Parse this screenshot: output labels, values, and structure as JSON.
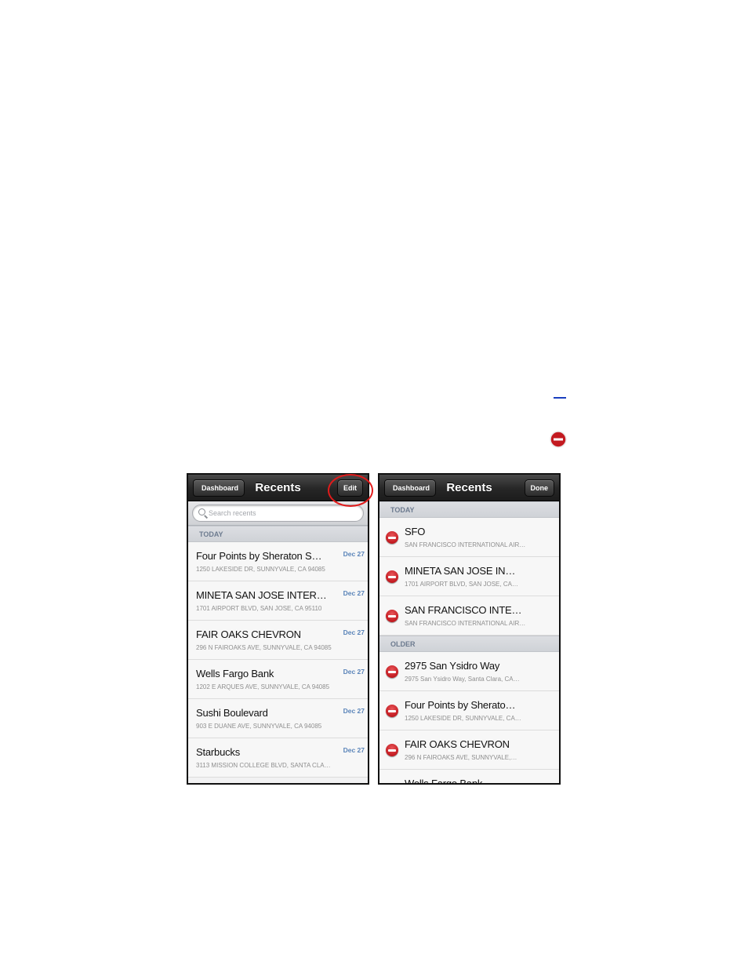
{
  "doc": {
    "link_text": ""
  },
  "left": {
    "nav": {
      "back_label": "Dashboard",
      "title": "Recents",
      "action_label": "Edit"
    },
    "search": {
      "placeholder": "Search recents"
    },
    "section": "TODAY",
    "items": [
      {
        "title": "Four Points by Sheraton S…",
        "subtitle": "1250 LAKESIDE DR, SUNNYVALE, CA 94085",
        "date": "Dec 27"
      },
      {
        "title": "MINETA SAN JOSE INTER…",
        "subtitle": "1701 AIRPORT BLVD, SAN JOSE, CA 95110",
        "date": "Dec 27"
      },
      {
        "title": "FAIR OAKS CHEVRON",
        "subtitle": "296 N FAIROAKS AVE, SUNNYVALE, CA 94085",
        "date": "Dec 27"
      },
      {
        "title": "Wells Fargo Bank",
        "subtitle": "1202 E ARQUES AVE, SUNNYVALE, CA 94085",
        "date": "Dec 27"
      },
      {
        "title": "Sushi Boulevard",
        "subtitle": "903 E DUANE AVE, SUNNYVALE, CA 94085",
        "date": "Dec 27"
      },
      {
        "title": "Starbucks",
        "subtitle": "3113 MISSION COLLEGE BLVD, SANTA CLA…",
        "date": "Dec 27"
      }
    ]
  },
  "right": {
    "nav": {
      "back_label": "Dashboard",
      "title": "Recents",
      "action_label": "Done"
    },
    "section_today": "TODAY",
    "today_items": [
      {
        "title": "SFO",
        "subtitle": "SAN FRANCISCO INTERNATIONAL AIR…"
      },
      {
        "title": "MINETA SAN JOSE IN…",
        "subtitle": "1701 AIRPORT BLVD, SAN JOSE, CA…"
      },
      {
        "title": "SAN FRANCISCO INTE…",
        "subtitle": "SAN FRANCISCO INTERNATIONAL AIR…"
      }
    ],
    "section_older": "OLDER",
    "older_items": [
      {
        "title": "2975 San Ysidro Way",
        "subtitle": "2975 San Ysidro Way, Santa Clara, CA…"
      },
      {
        "title": "Four Points by Sherato…",
        "subtitle": "1250 LAKESIDE DR, SUNNYVALE, CA…"
      },
      {
        "title": "FAIR OAKS CHEVRON",
        "subtitle": "296 N FAIROAKS AVE, SUNNYVALE,…"
      },
      {
        "title": "Wells Fargo Bank",
        "subtitle": ""
      }
    ]
  },
  "colors": {
    "delete_red": "#c31a20",
    "highlight_circle": "#e11b1b",
    "date_blue": "#5a84b9"
  }
}
